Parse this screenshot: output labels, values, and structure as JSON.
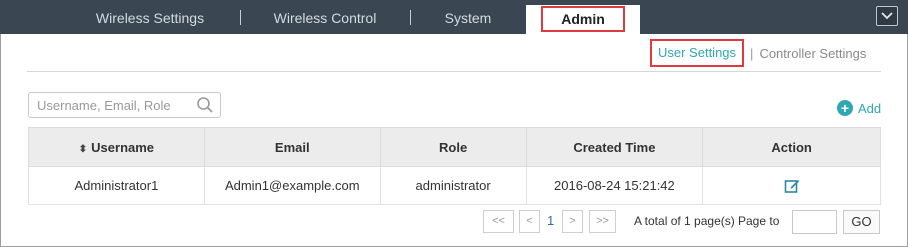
{
  "top_tabs": [
    {
      "label": "Wireless Settings"
    },
    {
      "label": "Wireless Control"
    },
    {
      "label": "System"
    },
    {
      "label": "Admin"
    }
  ],
  "sub_nav": {
    "active": "User Settings",
    "other": "Controller Settings",
    "separator": "|"
  },
  "search": {
    "placeholder": "Username, Email, Role",
    "value": ""
  },
  "add_label": "Add",
  "table": {
    "columns": [
      "Username",
      "Email",
      "Role",
      "Created Time",
      "Action"
    ],
    "rows": [
      {
        "username": "Administrator1",
        "email": "Admin1@example.com",
        "role": "administrator",
        "created": "2016-08-24 15:21:42"
      }
    ]
  },
  "pagination": {
    "first": "<<",
    "prev": "<",
    "current_page": "1",
    "next": ">",
    "last": ">>",
    "total_text": "A total of 1 page(s)",
    "page_to_label": "Page to",
    "page_input": "",
    "go_label": "GO"
  },
  "colors": {
    "topbar": "#3a4651",
    "accent": "#2fa7b5",
    "highlight_border": "#e0393e"
  }
}
